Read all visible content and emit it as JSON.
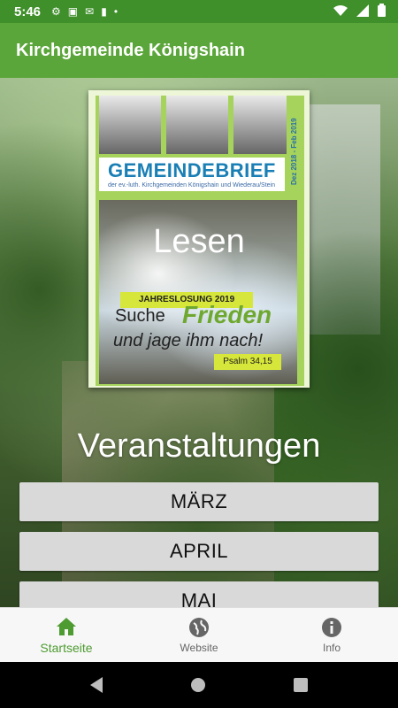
{
  "status": {
    "time": "5:46"
  },
  "appbar": {
    "title": "Kirchgemeinde Königshain"
  },
  "cover": {
    "title": "GEMEINDEBRIEF",
    "subtitle": "der ev.-luth. Kirchgemeinden Königshain und Wiederau/Stein",
    "date_range": "Dez 2018 - Feb 2019",
    "jahreslosung": "JAHRESLOSUNG 2019",
    "verse_part1": "Suche",
    "verse_part2": "Frieden",
    "verse_part3": "und jage ihm nach!",
    "psalm": "Psalm 34,15",
    "overlay": "Lesen"
  },
  "events": {
    "title": "Veranstaltungen",
    "months": [
      "MÄRZ",
      "APRIL",
      "MAI"
    ]
  },
  "bottom_nav": {
    "items": [
      {
        "label": "Startseite",
        "icon": "home-icon",
        "active": true
      },
      {
        "label": "Website",
        "icon": "globe-icon",
        "active": false
      },
      {
        "label": "Info",
        "icon": "info-icon",
        "active": false
      }
    ]
  },
  "colors": {
    "primary": "#5ba63a",
    "primary_dark": "#3f8f2b",
    "accent_active": "#4e9b31"
  }
}
